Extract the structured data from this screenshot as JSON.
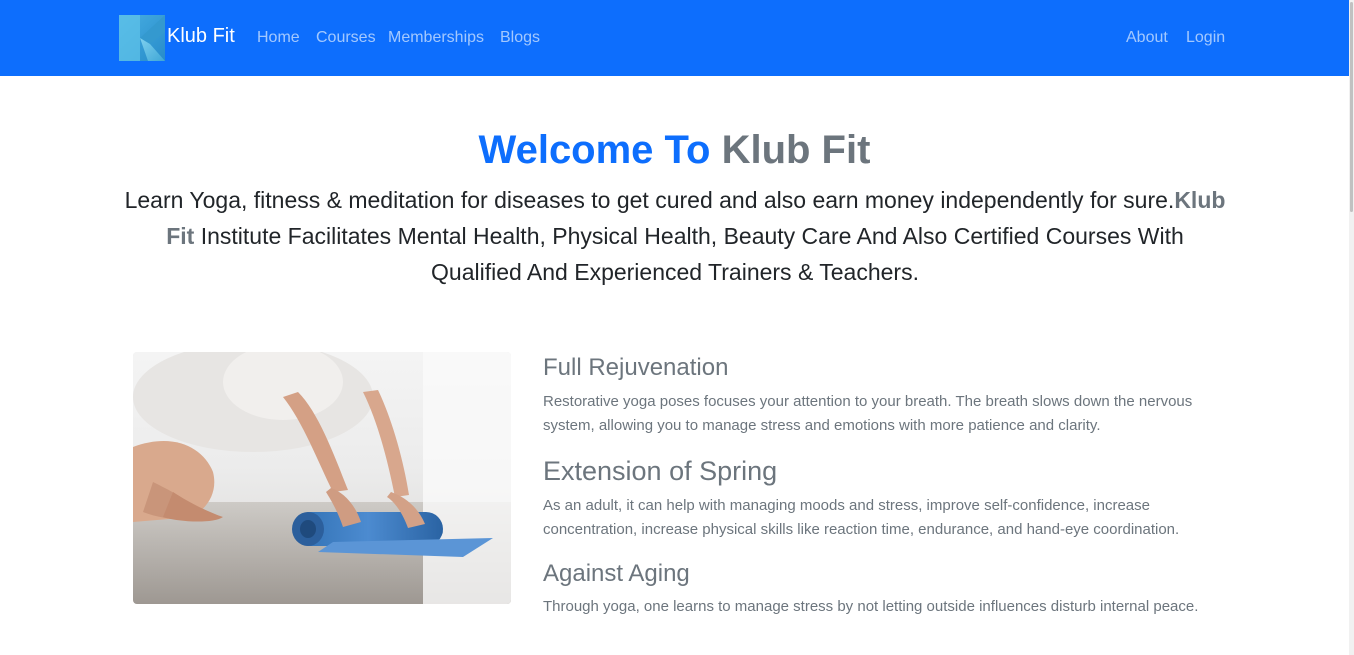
{
  "navbar": {
    "brand": "Klub Fit",
    "links": [
      "Home",
      "Courses",
      "Memberships",
      "Blogs"
    ],
    "right_links": [
      "About",
      "Login"
    ],
    "background": "#0d6efd"
  },
  "hero": {
    "title_part1": "Welcome To",
    "title_part2": "Klub Fit",
    "lead_part1": "Learn Yoga, fitness & meditation for diseases to get cured and also earn money independently for sure.",
    "lead_brand": "Klub Fit",
    "lead_part2": " Institute Facilitates Mental Health, Physical Health, Beauty Care And Also Certified Courses With Qualified And Experienced Trainers & Teachers."
  },
  "features": [
    {
      "title": "Full Rejuvenation",
      "text": "Restorative yoga poses focuses your attention to your breath. The breath slows down the nervous system, allowing you to manage stress and emotions with more patience and clarity."
    },
    {
      "title": "Extension of Spring",
      "text": "As an adult, it can help with managing moods and stress, improve self-confidence, increase concentration, increase physical skills like reaction time, endurance, and hand-eye coordination."
    },
    {
      "title": "Against Aging",
      "text": "Through yoga, one learns to manage stress by not letting outside influences disturb internal peace."
    }
  ],
  "colors": {
    "primary": "#0d6efd",
    "muted": "#6c757d",
    "text": "#212529"
  }
}
